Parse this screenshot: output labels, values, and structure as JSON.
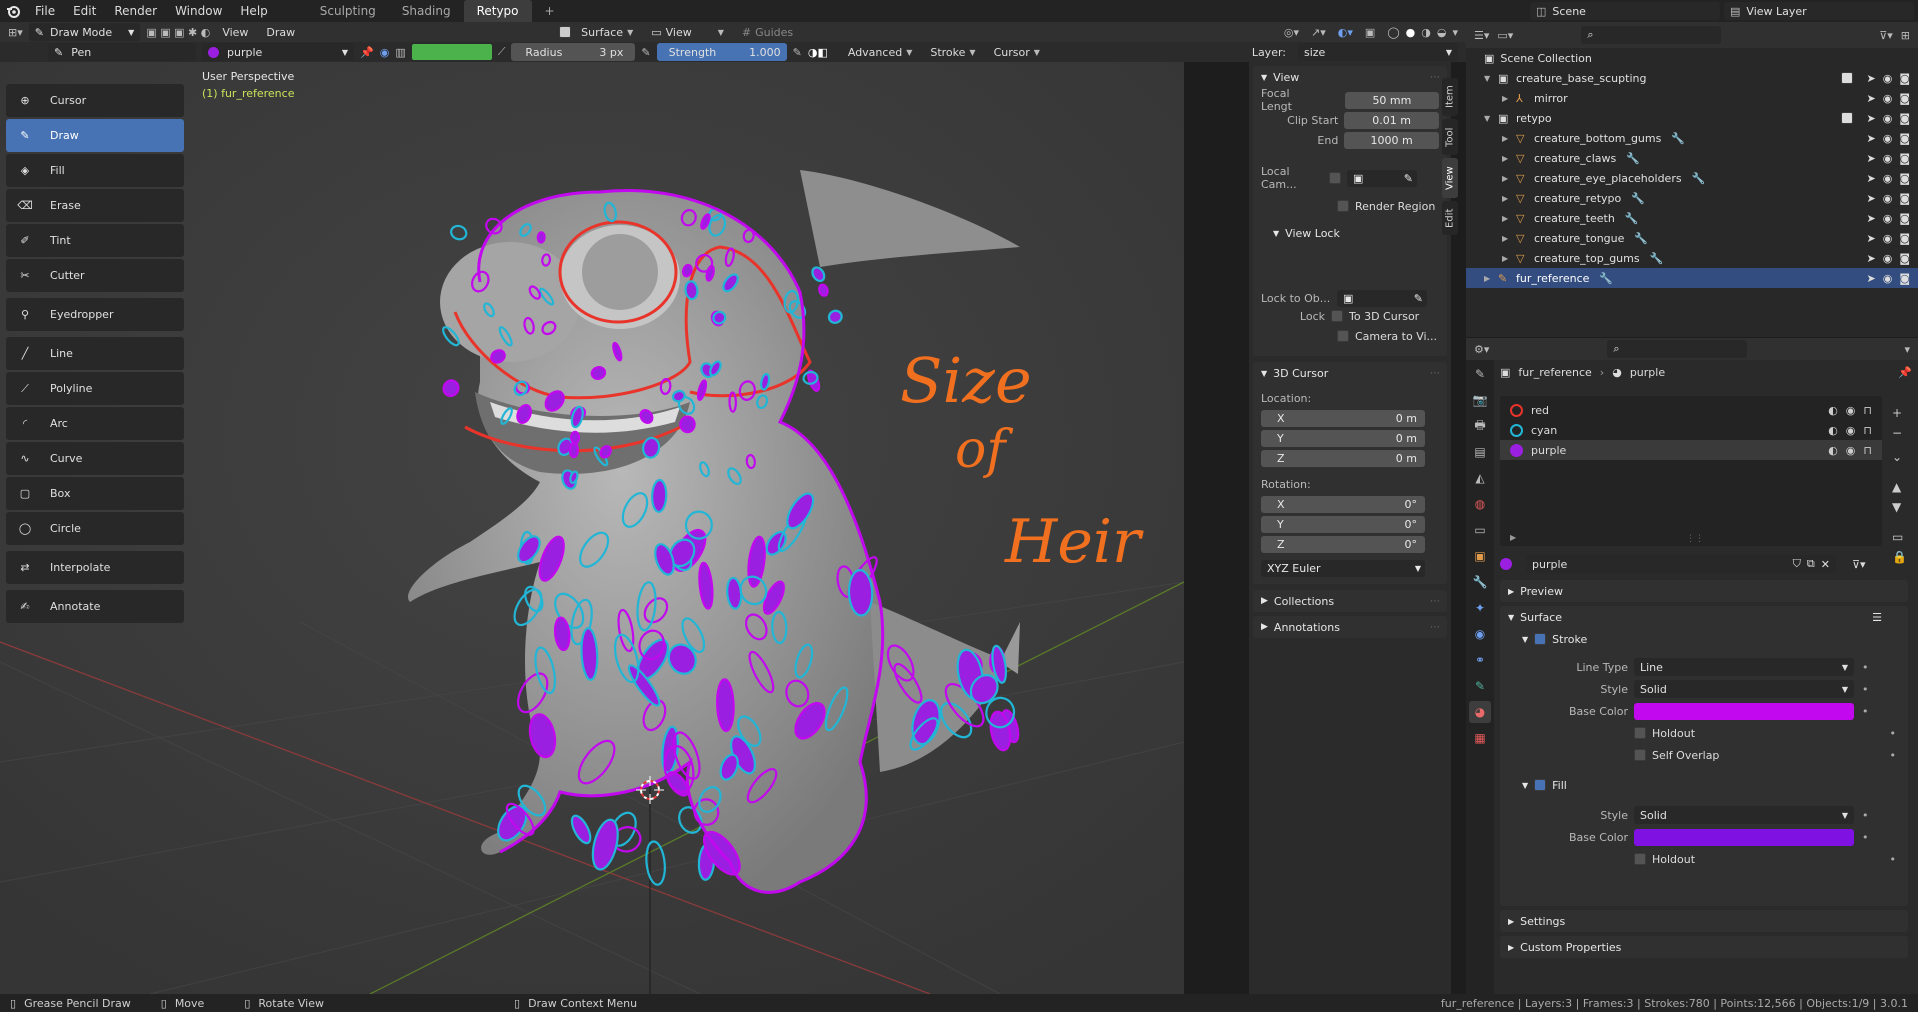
{
  "menubar": {
    "items": [
      "File",
      "Edit",
      "Render",
      "Window",
      "Help"
    ],
    "workspaces": [
      "Sculpting",
      "Shading",
      "Retypo"
    ],
    "active_workspace": "Retypo",
    "add_tab": "+",
    "scene": "Scene",
    "view_layer": "View Layer"
  },
  "viewport_header": {
    "mode": "Draw Mode",
    "view_menu": "View",
    "draw_menu": "Draw",
    "placement": "Surface",
    "orientation": "View",
    "guides": "Guides"
  },
  "tool_settings": {
    "brush": "Pen",
    "material": "purple",
    "radius_label": "Radius",
    "radius_value": "3 px",
    "strength_label": "Strength",
    "strength_value": "1.000",
    "strength_fraction": 1.0,
    "advanced": "Advanced",
    "stroke": "Stroke",
    "cursor": "Cursor",
    "layer_label": "Layer:",
    "layer_value": "size",
    "vertex_color": "#4cb24c"
  },
  "viewport": {
    "view_name": "User Perspective",
    "object_name": "(1) fur_reference",
    "annotation_words": [
      "Size",
      "of",
      "Heir"
    ]
  },
  "toolbar": [
    {
      "label": "Cursor",
      "icon": "cursor-icon",
      "selected": false
    },
    {
      "label": "Draw",
      "icon": "draw-icon",
      "selected": true
    },
    {
      "label": "Fill",
      "icon": "fill-icon",
      "selected": false
    },
    {
      "label": "Erase",
      "icon": "erase-icon",
      "selected": false
    },
    {
      "label": "Tint",
      "icon": "tint-icon",
      "selected": false
    },
    {
      "label": "Cutter",
      "icon": "cutter-icon",
      "selected": false
    },
    {
      "label": "Eyedropper",
      "icon": "eyedropper-icon",
      "selected": false
    },
    {
      "label": "Line",
      "icon": "line-icon",
      "selected": false
    },
    {
      "label": "Polyline",
      "icon": "polyline-icon",
      "selected": false
    },
    {
      "label": "Arc",
      "icon": "arc-icon",
      "selected": false
    },
    {
      "label": "Curve",
      "icon": "curve-icon",
      "selected": false
    },
    {
      "label": "Box",
      "icon": "box-icon",
      "selected": false
    },
    {
      "label": "Circle",
      "icon": "circle-icon",
      "selected": false
    },
    {
      "label": "Interpolate",
      "icon": "interpolate-icon",
      "selected": false
    },
    {
      "label": "Annotate",
      "icon": "annotate-icon",
      "selected": false
    }
  ],
  "npanel": {
    "view_header": "View",
    "focal_label": "Focal Lengt",
    "focal_value": "50 mm",
    "clip_start_label": "Clip Start",
    "clip_start_value": "0.01 m",
    "end_label": "End",
    "end_value": "1000 m",
    "local_cam_label": "Local Cam...",
    "render_region": "Render Region",
    "view_lock_header": "View Lock",
    "lock_to_obj_label": "Lock to Ob...",
    "lock_label": "Lock",
    "to_3d_cursor": "To 3D Cursor",
    "camera_to_view": "Camera to Vi...",
    "cursor_header": "3D Cursor",
    "location_label": "Location:",
    "loc_x_label": "X",
    "loc_x": "0 m",
    "loc_y_label": "Y",
    "loc_y": "0 m",
    "loc_z_label": "Z",
    "loc_z": "0 m",
    "rotation_label": "Rotation:",
    "rot_x_label": "X",
    "rot_x": "0°",
    "rot_y_label": "Y",
    "rot_y": "0°",
    "rot_z_label": "Z",
    "rot_z": "0°",
    "rot_mode": "XYZ Euler",
    "collections_header": "Collections",
    "annotations_header": "Annotations",
    "tabs": [
      "Item",
      "Tool",
      "View",
      "Edit"
    ],
    "active_tab": "View"
  },
  "outliner": {
    "root": "Scene Collection",
    "rows": [
      {
        "label": "creature_base_scupting",
        "level": 1,
        "kind": "collection"
      },
      {
        "label": "mirror",
        "level": 2,
        "kind": "empty"
      },
      {
        "label": "retypo",
        "level": 1,
        "kind": "collection"
      },
      {
        "label": "creature_bottom_gums",
        "level": 2,
        "kind": "mesh"
      },
      {
        "label": "creature_claws",
        "level": 2,
        "kind": "mesh"
      },
      {
        "label": "creature_eye_placeholders",
        "level": 2,
        "kind": "mesh"
      },
      {
        "label": "creature_retypo",
        "level": 2,
        "kind": "mesh"
      },
      {
        "label": "creature_teeth",
        "level": 2,
        "kind": "mesh"
      },
      {
        "label": "creature_tongue",
        "level": 2,
        "kind": "mesh"
      },
      {
        "label": "creature_top_gums",
        "level": 2,
        "kind": "mesh"
      },
      {
        "label": "fur_reference",
        "level": 1,
        "kind": "gpencil"
      }
    ],
    "selected": "fur_reference"
  },
  "properties": {
    "breadcrumb_object": "fur_reference",
    "breadcrumb_material": "purple",
    "materials": [
      {
        "name": "red",
        "color": "#e8342a",
        "ring": true
      },
      {
        "name": "cyan",
        "color": "#22b6d6",
        "ring": true
      },
      {
        "name": "purple",
        "color": "#9a1fe0",
        "ring": false
      }
    ],
    "active_material": "purple",
    "material_field": "purple",
    "preview": "Preview",
    "surface": "Surface",
    "stroke": "Stroke",
    "line_type_label": "Line Type",
    "line_type": "Line",
    "style_label": "Style",
    "style": "Solid",
    "base_color_label": "Base Color",
    "stroke_color": "#c208ef",
    "holdout": "Holdout",
    "self_overlap": "Self Overlap",
    "fill": "Fill",
    "fill_style_label": "Style",
    "fill_style": "Solid",
    "fill_base_color_label": "Base Color",
    "fill_color": "#7f11e2",
    "fill_holdout": "Holdout",
    "settings": "Settings",
    "custom_properties": "Custom Properties"
  },
  "statusbar": {
    "left1": "Grease Pencil Draw",
    "left2": "Move",
    "left3": "Rotate View",
    "left4": "Draw Context Menu",
    "stats": "fur_reference | Layers:3 | Frames:3 | Strokes:780 | Points:12,566 | Objects:1/9 | 3.0.1"
  }
}
